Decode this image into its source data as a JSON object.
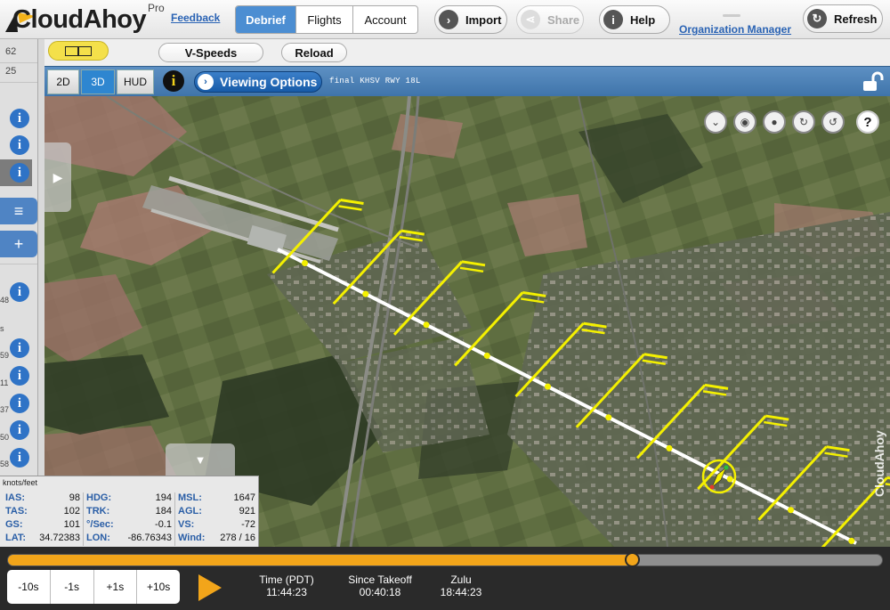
{
  "header": {
    "logo_text": "CloudAhoy",
    "logo_tier": "Pro",
    "feedback_link": "Feedback",
    "tabs": [
      {
        "label": "Debrief",
        "active": true
      },
      {
        "label": "Flights",
        "active": false
      },
      {
        "label": "Account",
        "active": false
      }
    ],
    "import_label": "Import",
    "share_label": "Share",
    "help_label": "Help",
    "organization_link": "Organization Manager",
    "refresh_label": "Refresh"
  },
  "toolbar": {
    "vspeeds_label": "V-Speeds",
    "reload_label": "Reload"
  },
  "view_modes": [
    {
      "label": "2D",
      "active": false
    },
    {
      "label": "3D",
      "active": true
    },
    {
      "label": "HUD",
      "active": false
    }
  ],
  "viewing_options_label": "Viewing Options",
  "approach_label": "final KHSV RWY 18L",
  "flight_list": {
    "numbers": [
      "62",
      "25"
    ],
    "partial_values": [
      "48",
      "s",
      "59",
      "11",
      "37",
      "50",
      "58"
    ]
  },
  "watermark": "CloudAhoy",
  "telemetry": {
    "units": "knots/feet",
    "col1": [
      {
        "label": "IAS:",
        "value": "98"
      },
      {
        "label": "TAS:",
        "value": "102"
      },
      {
        "label": "GS:",
        "value": "101"
      },
      {
        "label": "LAT:",
        "value": "34.72383"
      }
    ],
    "col2": [
      {
        "label": "HDG:",
        "value": "194"
      },
      {
        "label": "TRK:",
        "value": "184"
      },
      {
        "label": "°/Sec:",
        "value": "-0.1"
      },
      {
        "label": "LON:",
        "value": "-86.76343"
      }
    ],
    "col3": [
      {
        "label": "MSL:",
        "value": "1647"
      },
      {
        "label": "AGL:",
        "value": "921"
      },
      {
        "label": "VS:",
        "value": "-72"
      },
      {
        "label": "Wind:",
        "value": "278 / 16"
      }
    ]
  },
  "timeline": {
    "progress_fraction": 0.713,
    "skip_buttons": [
      "-10s",
      "-1s",
      "+1s",
      "+10s"
    ],
    "time_label": "Time (PDT)",
    "time_value": "11:44:23",
    "since_takeoff_label": "Since Takeoff",
    "since_takeoff_value": "00:40:18",
    "zulu_label": "Zulu",
    "zulu_value": "18:44:23"
  },
  "colors": {
    "accent_blue": "#4c8ed2",
    "info_blue": "#2f73c6",
    "timeline_orange": "#f2a51a",
    "hud_yellow": "#f4f000"
  }
}
